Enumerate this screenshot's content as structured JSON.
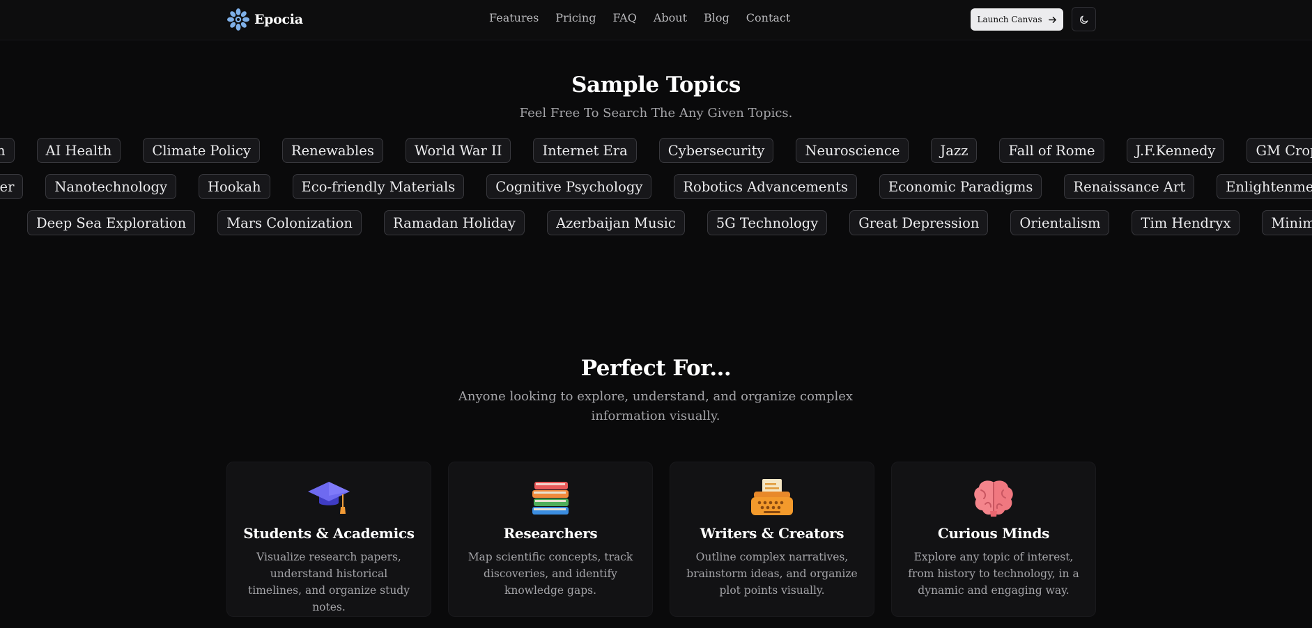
{
  "nav": {
    "brand": "Epocia",
    "links": [
      "Features",
      "Pricing",
      "FAQ",
      "About",
      "Blog",
      "Contact"
    ],
    "launch_label": "Launch Canvas"
  },
  "topics": {
    "title": "Sample Topics",
    "subtitle": "Feel Free To Search The Any Given Topics.",
    "row1": [
      "oin",
      "AI Health",
      "Climate Policy",
      "Renewables",
      "World War II",
      "Internet Era",
      "Cybersecurity",
      "Neuroscience",
      "Jazz",
      "Fall of Rome",
      "J.F.Kennedy",
      "GM Crops"
    ],
    "row2": [
      "her",
      "Nanotechnology",
      "Hookah",
      "Eco-friendly Materials",
      "Cognitive Psychology",
      "Robotics Advancements",
      "Economic Paradigms",
      "Renaissance Art",
      "Enlightenment T"
    ],
    "row3": [
      "Deep Sea Exploration",
      "Mars Colonization",
      "Ramadan Holiday",
      "Azerbaijan Music",
      "5G Technology",
      "Great Depression",
      "Orientalism",
      "Tim Hendryx",
      "Minimalist D"
    ]
  },
  "perfect": {
    "title": "Perfect For...",
    "subtitle": "Anyone looking to explore, understand, and organize complex information visually.",
    "cards": [
      {
        "title": "Students & Academics",
        "desc": "Visualize research papers, understand historical timelines, and organize study notes.",
        "icon": "graduation-cap-icon"
      },
      {
        "title": "Researchers",
        "desc": "Map scientific concepts, track discoveries, and identify knowledge gaps.",
        "icon": "books-icon"
      },
      {
        "title": "Writers & Creators",
        "desc": "Outline complex narratives, brainstorm ideas, and organize plot points visually.",
        "icon": "typewriter-icon"
      },
      {
        "title": "Curious Minds",
        "desc": "Explore any topic of interest, from history to technology, in a dynamic and engaging way.",
        "icon": "brain-icon"
      }
    ]
  },
  "colors": {
    "background": "#0a0a0b",
    "brand_icon": "#7fb0e8",
    "chip_border": "#38383d"
  }
}
